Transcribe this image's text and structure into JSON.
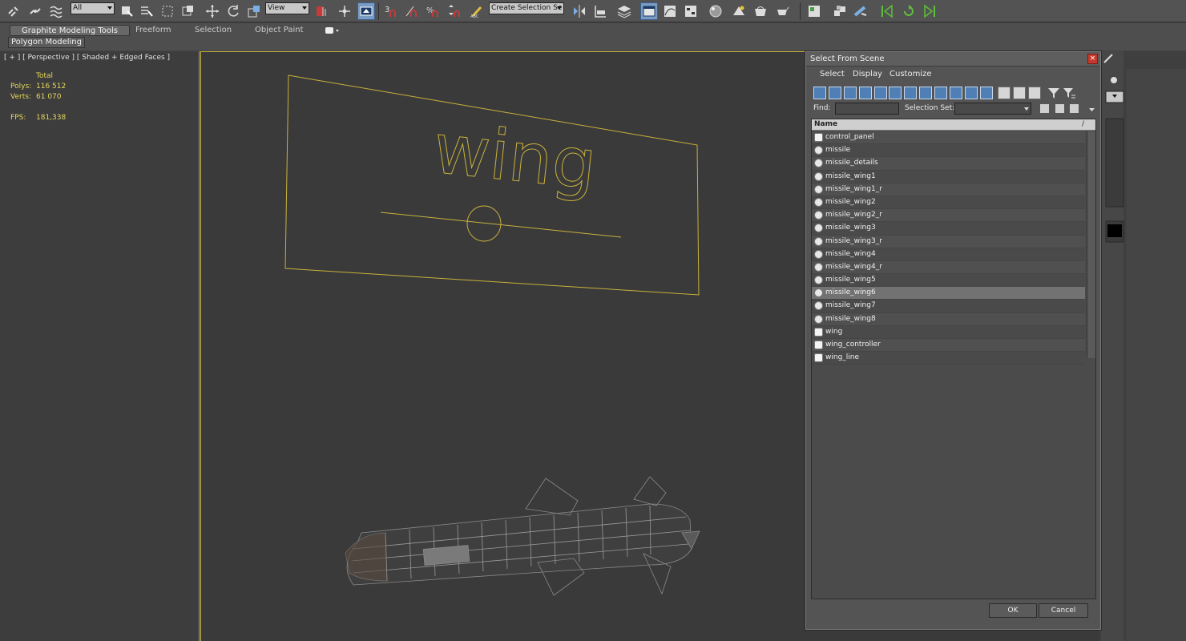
{
  "toolbar": {
    "filter_value": "All",
    "ref_coord_value": "View",
    "named_selection_placeholder": "Create Selection Se"
  },
  "ribbon": {
    "tabs": [
      "Graphite Modeling Tools",
      "Freeform",
      "Selection",
      "Object Paint"
    ],
    "subtab": "Polygon Modeling"
  },
  "left_viewport": {
    "label": "[ + ] [ Perspective ] [ Shaded + Edged Faces ]",
    "stats": {
      "total_label": "Total",
      "polys_label": "Polys:",
      "polys_value": "116 512",
      "verts_label": "Verts:",
      "verts_value": "61 070",
      "fps_label": "FPS:",
      "fps_value": "181,338"
    }
  },
  "scene": {
    "wing_text": "wing"
  },
  "dialog": {
    "title": "Select From Scene",
    "menu": [
      "Select",
      "Display",
      "Customize"
    ],
    "find_label": "Find:",
    "find_value": "",
    "selection_set_label": "Selection Set:",
    "column_name": "Name",
    "column_sort": "/",
    "items": [
      {
        "name": "control_panel",
        "kind": "shape"
      },
      {
        "name": "missile",
        "kind": "geometry"
      },
      {
        "name": "missile_details",
        "kind": "geometry"
      },
      {
        "name": "missile_wing1",
        "kind": "geometry"
      },
      {
        "name": "missile_wing1_r",
        "kind": "geometry"
      },
      {
        "name": "missile_wing2",
        "kind": "geometry"
      },
      {
        "name": "missile_wing2_r",
        "kind": "geometry"
      },
      {
        "name": "missile_wing3",
        "kind": "geometry"
      },
      {
        "name": "missile_wing3_r",
        "kind": "geometry"
      },
      {
        "name": "missile_wing4",
        "kind": "geometry"
      },
      {
        "name": "missile_wing4_r",
        "kind": "geometry"
      },
      {
        "name": "missile_wing5",
        "kind": "geometry"
      },
      {
        "name": "missile_wing6",
        "kind": "geometry",
        "selected": true
      },
      {
        "name": "missile_wing7",
        "kind": "geometry"
      },
      {
        "name": "missile_wing8",
        "kind": "geometry"
      },
      {
        "name": "wing",
        "kind": "shape"
      },
      {
        "name": "wing_controller",
        "kind": "shape"
      },
      {
        "name": "wing_line",
        "kind": "shape"
      }
    ],
    "ok_label": "OK",
    "cancel_label": "Cancel"
  },
  "colors": {
    "stats_text": "#e6d65a",
    "wireframe": "#c8b13c",
    "selection_highlight": "#7a9cc4",
    "close_button": "#c63a2e"
  }
}
